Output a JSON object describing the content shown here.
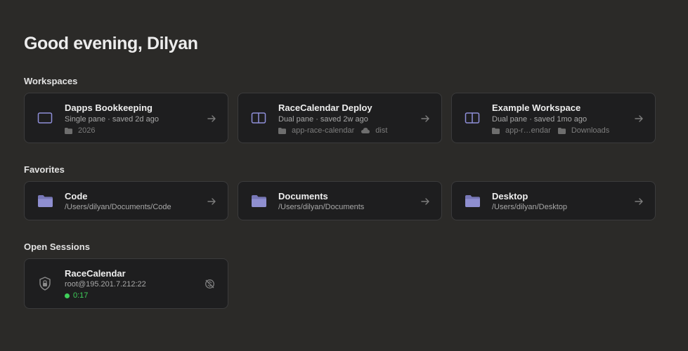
{
  "greeting": "Good evening, Dilyan",
  "sections": {
    "workspaces": "Workspaces",
    "favorites": "Favorites",
    "sessions": "Open Sessions"
  },
  "workspaces": [
    {
      "title": "Dapps Bookkeeping",
      "subtitle": "Single pane · saved 2d ago",
      "icon": "single-pane-icon",
      "tags": [
        "2026"
      ]
    },
    {
      "title": "RaceCalendar Deploy",
      "subtitle": "Dual pane · saved 2w ago",
      "icon": "dual-pane-icon",
      "tags": [
        "app-race-calendar",
        "dist"
      ]
    },
    {
      "title": "Example Workspace",
      "subtitle": "Dual pane · saved 1mo ago",
      "icon": "dual-pane-icon",
      "tags": [
        "app-r…endar",
        "Downloads"
      ]
    }
  ],
  "favorites": [
    {
      "title": "Code",
      "path": "/Users/dilyan/Documents/Code",
      "icon": "folder-icon"
    },
    {
      "title": "Documents",
      "path": "/Users/dilyan/Documents",
      "icon": "folder-icon"
    },
    {
      "title": "Desktop",
      "path": "/Users/dilyan/Desktop",
      "icon": "folder-icon"
    }
  ],
  "sessions": [
    {
      "title": "RaceCalendar",
      "host": "root@195.201.7.212:22",
      "uptime": "0:17",
      "icon": "shield-lock-icon",
      "action_icon": "disconnect-icon"
    }
  ],
  "colors": {
    "background": "#2b2a28",
    "card": "#1e1e1f",
    "border": "#3b3b3c",
    "accent": "#8f8fd9",
    "online": "#3fcf5a"
  }
}
